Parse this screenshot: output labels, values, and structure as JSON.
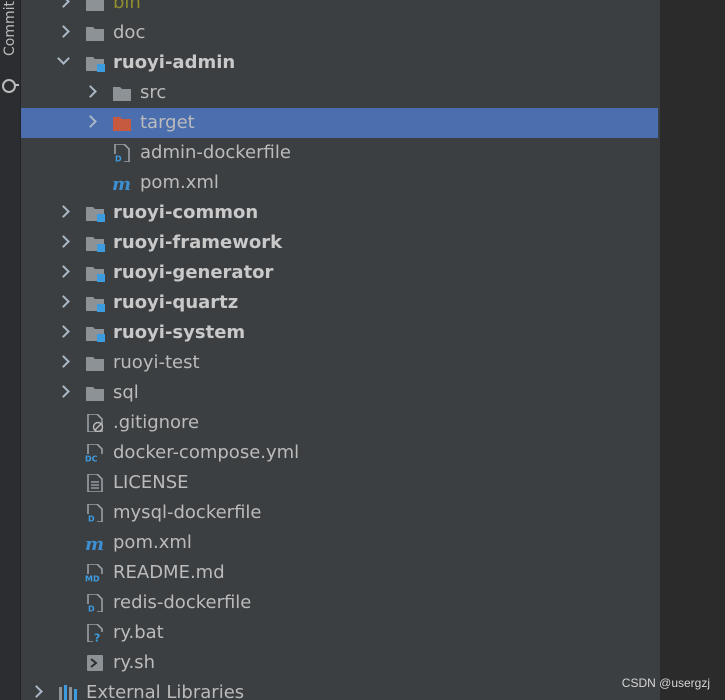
{
  "stripe": {
    "commit_label": "Commit"
  },
  "tree": {
    "items": [
      {
        "label": "bin",
        "style": "olive",
        "arrow": "right",
        "icon": "folder-icon"
      },
      {
        "label": "doc",
        "style": "normal",
        "arrow": "right",
        "icon": "folder-icon"
      },
      {
        "label": "ruoyi-admin",
        "style": "bold",
        "arrow": "down",
        "icon": "module-folder-icon"
      },
      {
        "label": "src",
        "style": "normal",
        "arrow": "right",
        "icon": "folder-icon"
      },
      {
        "label": "target",
        "style": "normal",
        "arrow": "right",
        "icon": "excluded-folder-icon",
        "selected": true
      },
      {
        "label": "admin-dockerfile",
        "style": "normal",
        "icon": "dockerfile-icon"
      },
      {
        "label": "pom.xml",
        "style": "normal",
        "icon": "maven-icon"
      },
      {
        "label": "ruoyi-common",
        "style": "bold",
        "arrow": "right",
        "icon": "module-folder-icon"
      },
      {
        "label": "ruoyi-framework",
        "style": "bold",
        "arrow": "right",
        "icon": "module-folder-icon"
      },
      {
        "label": "ruoyi-generator",
        "style": "bold",
        "arrow": "right",
        "icon": "module-folder-icon"
      },
      {
        "label": "ruoyi-quartz",
        "style": "bold",
        "arrow": "right",
        "icon": "module-folder-icon"
      },
      {
        "label": "ruoyi-system",
        "style": "bold",
        "arrow": "right",
        "icon": "module-folder-icon"
      },
      {
        "label": "ruoyi-test",
        "style": "normal",
        "arrow": "right",
        "icon": "folder-icon"
      },
      {
        "label": "sql",
        "style": "normal",
        "arrow": "right",
        "icon": "folder-icon"
      },
      {
        "label": ".gitignore",
        "style": "normal",
        "icon": "gitignore-icon"
      },
      {
        "label": "docker-compose.yml",
        "style": "normal",
        "icon": "docker-compose-icon"
      },
      {
        "label": "LICENSE",
        "style": "normal",
        "icon": "text-file-icon"
      },
      {
        "label": "mysql-dockerfile",
        "style": "normal",
        "icon": "dockerfile-icon"
      },
      {
        "label": "pom.xml",
        "style": "normal",
        "icon": "maven-icon"
      },
      {
        "label": "README.md",
        "style": "normal",
        "icon": "markdown-icon"
      },
      {
        "label": "redis-dockerfile",
        "style": "normal",
        "icon": "dockerfile-icon"
      },
      {
        "label": "ry.bat",
        "style": "normal",
        "icon": "unknown-file-icon"
      },
      {
        "label": "ry.sh",
        "style": "normal",
        "icon": "shell-script-icon"
      },
      {
        "label": "External Libraries",
        "style": "normal",
        "arrow": "right",
        "icon": "library-icon"
      }
    ]
  },
  "watermark": "CSDN @usergzj",
  "colors": {
    "selection": "#4b6eaf",
    "panel": "#3c3f41",
    "text": "#bbbbbb",
    "folder": "#8c9296",
    "module_badge": "#3d9ce0",
    "excluded_folder": "#c55a40"
  }
}
